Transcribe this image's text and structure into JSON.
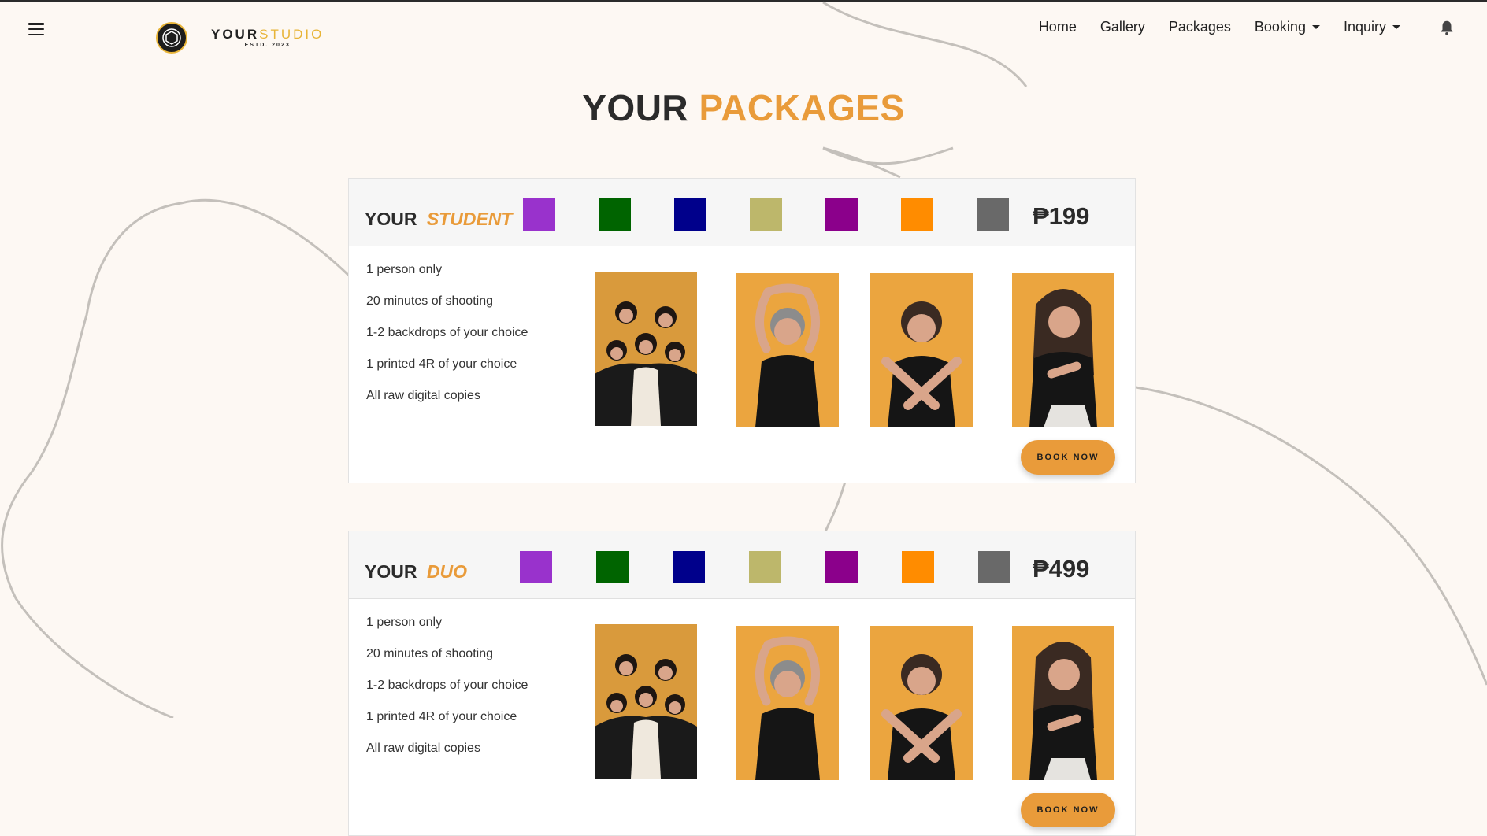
{
  "navbar": {
    "menu_icon": "hamburger-menu-icon",
    "brand": {
      "name_part1": "YOUR",
      "name_part2": "STUDIO",
      "established": "ESTD. 2023",
      "logo_icon": "camera-aperture-icon"
    },
    "links": [
      {
        "label": "Home",
        "dropdown": false
      },
      {
        "label": "Gallery",
        "dropdown": false
      },
      {
        "label": "Packages",
        "dropdown": false
      },
      {
        "label": "Booking",
        "dropdown": true
      },
      {
        "label": "Inquiry",
        "dropdown": true
      }
    ],
    "notification_icon": "bell-icon"
  },
  "page": {
    "title_part1": "YOUR",
    "title_part2": "PACKAGES"
  },
  "colors": {
    "accent": "#e99b3a",
    "brand_gold": "#e8b437",
    "background": "#fdf8f3",
    "swatches": [
      "#9932CC",
      "#006400",
      "#00008B",
      "#BDB76B",
      "#8B008B",
      "#FF8C00",
      "#696969"
    ]
  },
  "packages": [
    {
      "title_part1": "YOUR",
      "title_part2": "STUDENT",
      "price": "₱199",
      "features": [
        "1 person only",
        "20 minutes of shooting",
        "1-2 backdrops of your choice",
        "1 printed 4R of your choice",
        "All raw digital copies"
      ],
      "photos": [
        "group-photo",
        "arms-up-pose",
        "crossed-arms-pose",
        "peace-sign-pose"
      ],
      "book_label": "BOOK NOW"
    },
    {
      "title_part1": "YOUR",
      "title_part2": "DUO",
      "price": "₱499",
      "features": [
        "1 person only",
        "20 minutes of shooting",
        "1-2 backdrops of your choice",
        "1 printed 4R of your choice",
        "All raw digital copies"
      ],
      "photos": [
        "group-photo",
        "arms-up-pose",
        "crossed-arms-pose",
        "peace-sign-pose"
      ],
      "book_label": "BOOK NOW"
    }
  ]
}
